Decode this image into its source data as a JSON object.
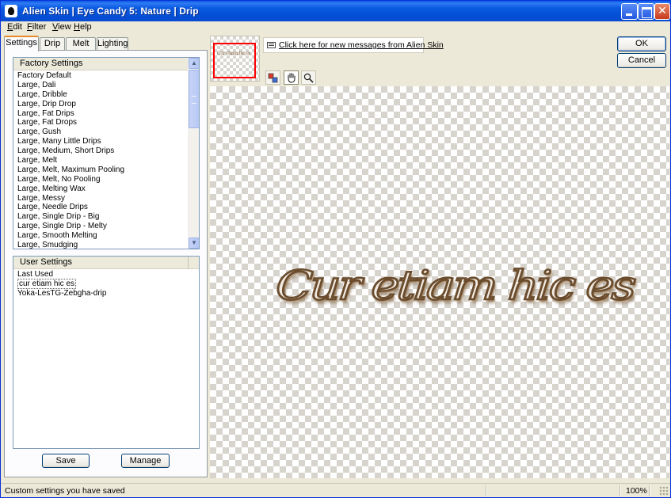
{
  "window": {
    "title": "Alien Skin | Eye Candy 5: Nature | Drip"
  },
  "menu": [
    {
      "label_u": "E",
      "label_rest": "dit"
    },
    {
      "label_u": "F",
      "label_rest": "ilter"
    },
    {
      "label_u": "V",
      "label_rest": "iew"
    },
    {
      "label_u": "H",
      "label_rest": "elp"
    }
  ],
  "tabs": [
    {
      "label": "Settings",
      "active": true
    },
    {
      "label": "Drip"
    },
    {
      "label": "Melt"
    },
    {
      "label": "Lighting"
    }
  ],
  "factory_settings": {
    "header": "Factory Settings",
    "items": [
      "Factory Default",
      "Large, Dali",
      "Large, Dribble",
      "Large, Drip Drop",
      "Large, Fat Drips",
      "Large, Fat Drops",
      "Large, Gush",
      "Large, Many Little Drips",
      "Large, Medium, Short Drips",
      "Large, Melt",
      "Large, Melt, Maximum Pooling",
      "Large, Melt, No Pooling",
      "Large, Melting Wax",
      "Large, Messy",
      "Large, Needle Drips",
      "Large, Single Drip - Big",
      "Large, Single Drip - Melty",
      "Large, Smooth Melting",
      "Large, Smudging"
    ]
  },
  "user_settings": {
    "header": "User Settings",
    "items": [
      {
        "label": "Last Used"
      },
      {
        "label": "cur etiam hic es",
        "selected": true
      },
      {
        "label": "Yoka-LesTG-Zebgha-drip"
      }
    ]
  },
  "buttons": {
    "save": "Save",
    "manage": "Manage",
    "ok": "OK",
    "cancel": "Cancel"
  },
  "messages_link": "Click here for new messages from Alien Skin",
  "toolbar": {
    "icons": [
      "preview-toggle-icon",
      "hand-tool-icon",
      "zoom-tool-icon"
    ]
  },
  "preview_text": "Cur etiam hic es",
  "status": {
    "text": "Custom settings you have saved",
    "zoom": "100%"
  }
}
